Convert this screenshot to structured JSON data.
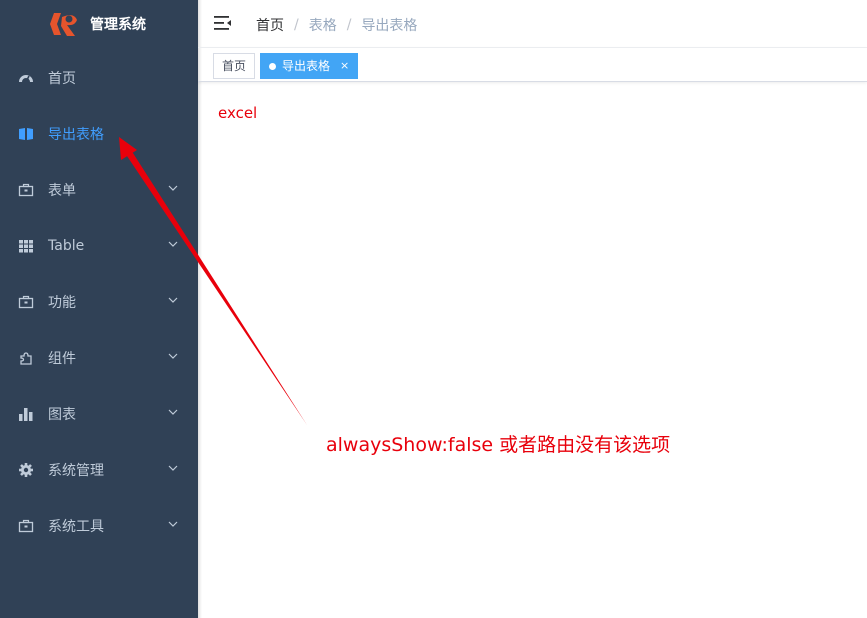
{
  "sidebar": {
    "logo_text": "管理系统",
    "items": [
      {
        "label": "首页",
        "icon": "dashboard-icon",
        "has_children": false,
        "active": false
      },
      {
        "label": "导出表格",
        "icon": "book-icon",
        "has_children": false,
        "active": true
      },
      {
        "label": "表单",
        "icon": "briefcase-icon",
        "has_children": true,
        "active": false
      },
      {
        "label": "Table",
        "icon": "grid-icon",
        "has_children": true,
        "active": false
      },
      {
        "label": "功能",
        "icon": "briefcase-icon",
        "has_children": true,
        "active": false
      },
      {
        "label": "组件",
        "icon": "puzzle-icon",
        "has_children": true,
        "active": false
      },
      {
        "label": "图表",
        "icon": "bar-chart-icon",
        "has_children": true,
        "active": false
      },
      {
        "label": "系统管理",
        "icon": "gear-icon",
        "has_children": true,
        "active": false
      },
      {
        "label": "系统工具",
        "icon": "briefcase-icon",
        "has_children": true,
        "active": false
      }
    ],
    "background": "#304156",
    "active_color": "#409eff"
  },
  "navbar": {
    "breadcrumb": [
      "首页",
      "表格",
      "导出表格"
    ]
  },
  "tags": {
    "home_label": "首页",
    "active_label": "导出表格",
    "close_symbol": "×",
    "active_color": "#42a5f5"
  },
  "main": {
    "text": "excel"
  },
  "annotation": {
    "text": "alwaysShow:false 或者路由没有该选项",
    "color": "#e8000b"
  }
}
